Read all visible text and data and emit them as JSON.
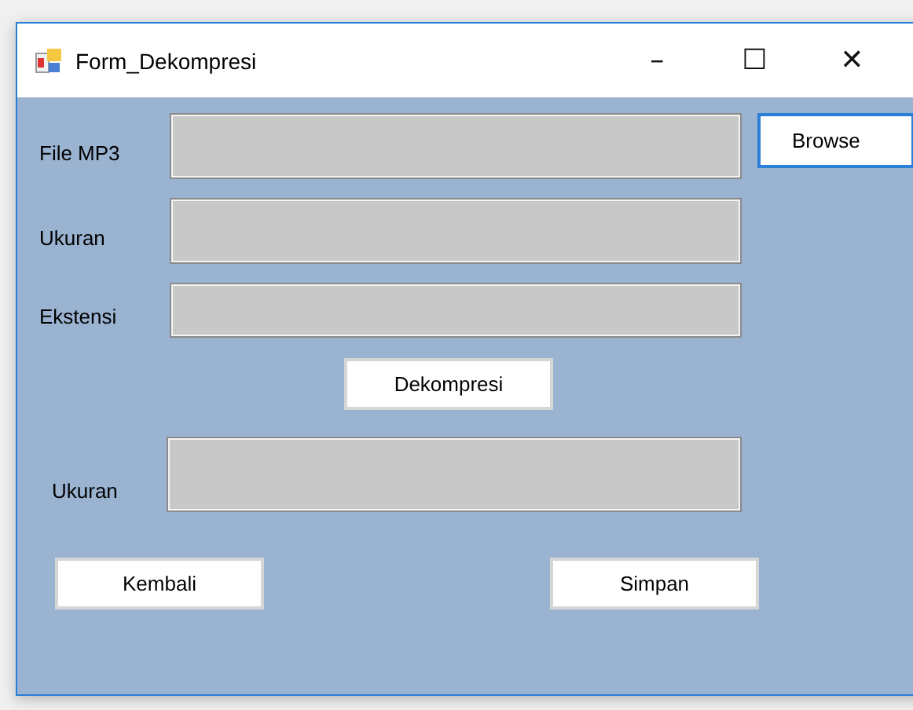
{
  "window": {
    "title": "Form_Dekompresi",
    "controls": [
      "–",
      "☐",
      "✕"
    ]
  },
  "input_rows": [
    {
      "label": "File MP3"
    },
    {
      "label": "Ukuran"
    },
    {
      "label": "Ekstensi"
    }
  ],
  "browse_button": {
    "label": "Browse",
    "focused": true
  },
  "decompress_button": {
    "label": "Dekompresi"
  },
  "result_row": {
    "label": "Ukuran"
  },
  "buttons": [
    {
      "label": "Kembali"
    },
    {
      "label": "Simpan"
    }
  ]
}
